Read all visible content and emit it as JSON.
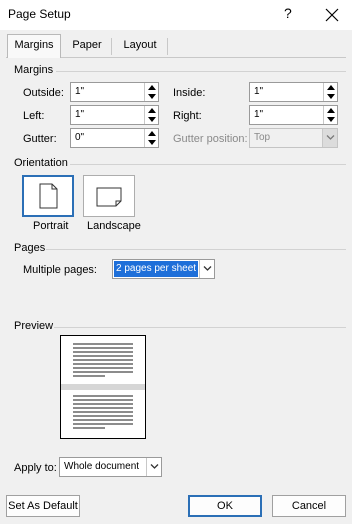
{
  "window": {
    "title": "Page Setup",
    "help": "?",
    "close_icon": "close-icon"
  },
  "tabs": [
    {
      "label": "Margins",
      "active": true
    },
    {
      "label": "Paper",
      "active": false
    },
    {
      "label": "Layout",
      "active": false
    }
  ],
  "margins": {
    "section_label": "Margins",
    "outside": {
      "label": "Outside:",
      "value": "1\""
    },
    "inside": {
      "label": "Inside:",
      "value": "1\""
    },
    "left": {
      "label": "Left:",
      "value": "1\""
    },
    "right": {
      "label": "Right:",
      "value": "1\""
    },
    "gutter": {
      "label": "Gutter:",
      "value": "0\""
    },
    "gutter_position": {
      "label": "Gutter position:",
      "value": "Top",
      "disabled": true
    }
  },
  "orientation": {
    "section_label": "Orientation",
    "portrait_label": "Portrait",
    "landscape_label": "Landscape",
    "selected": "Portrait"
  },
  "pages": {
    "section_label": "Pages",
    "multiple_pages_label": "Multiple pages:",
    "multiple_pages_value": "2 pages per sheet"
  },
  "preview": {
    "section_label": "Preview"
  },
  "apply_to": {
    "label": "Apply to:",
    "value": "Whole document"
  },
  "buttons": {
    "set_default": "Set As Default",
    "ok": "OK",
    "cancel": "Cancel"
  },
  "colors": {
    "accent": "#2b6fb6",
    "selection": "#1e6fd9"
  }
}
